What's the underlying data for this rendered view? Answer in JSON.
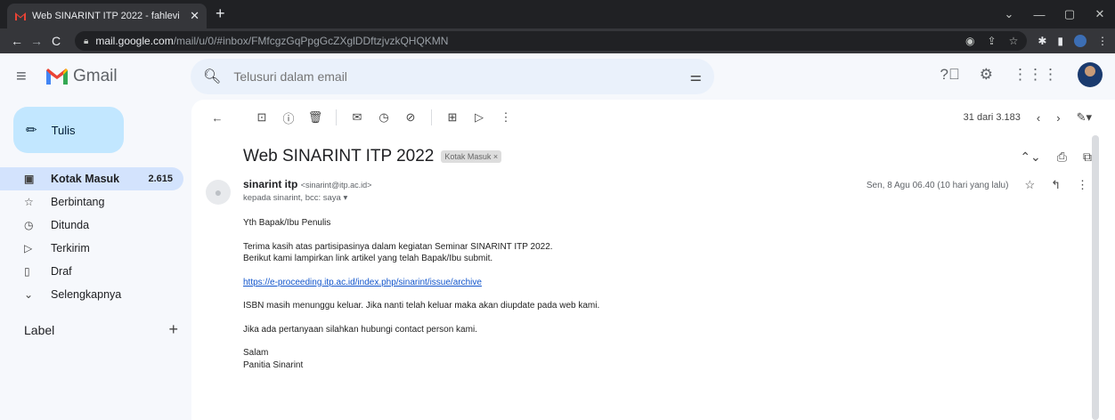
{
  "browser": {
    "tab_title": "Web SINARINT ITP 2022 - fahlevi",
    "url_host": "mail.google.com",
    "url_path": "/mail/u/0/#inbox/FMfcgzGqPpgGcZXglDDftzjvzkQHQKMN"
  },
  "gmail": {
    "logo_text": "Gmail",
    "search_placeholder": "Telusuri dalam email"
  },
  "sidebar": {
    "compose_label": "Tulis",
    "items": [
      {
        "label": "Kotak Masuk",
        "count": "2.615",
        "icon": "inbox-icon"
      },
      {
        "label": "Berbintang",
        "count": "",
        "icon": "star-icon"
      },
      {
        "label": "Ditunda",
        "count": "",
        "icon": "clock-icon"
      },
      {
        "label": "Terkirim",
        "count": "",
        "icon": "send-icon"
      },
      {
        "label": "Draf",
        "count": "",
        "icon": "draft-icon"
      },
      {
        "label": "Selengkapnya",
        "count": "",
        "icon": "chevron-down-icon"
      }
    ],
    "label_header": "Label"
  },
  "toolbar": {
    "pager_text": "31 dari 3.183"
  },
  "email": {
    "subject": "Web SINARINT ITP 2022",
    "label_chip": "Kotak Masuk ×",
    "sender_name": "sinarint itp",
    "sender_addr": "<sinarint@itp.ac.id>",
    "to_line": "kepada sinarint, bcc: saya ▾",
    "date": "Sen, 8 Agu 06.40 (10 hari yang lalu)",
    "body": {
      "greeting": "Yth Bapak/Ibu Penulis",
      "line1": "Terima kasih atas partisipasinya dalam kegiatan Seminar SINARINT ITP 2022.",
      "line2": "Berikut kami lampirkan link artikel yang telah Bapak/Ibu submit.",
      "link": "https://e-proceeding.itp.ac.id/index.php/sinarint/issue/archive",
      "line3": "ISBN masih menunggu keluar. Jika nanti telah keluar maka akan diupdate pada web kami.",
      "line4": "Jika ada pertanyaan silahkan hubungi contact person kami.",
      "closing1": "Salam",
      "closing2": "Panitia Sinarint"
    }
  }
}
